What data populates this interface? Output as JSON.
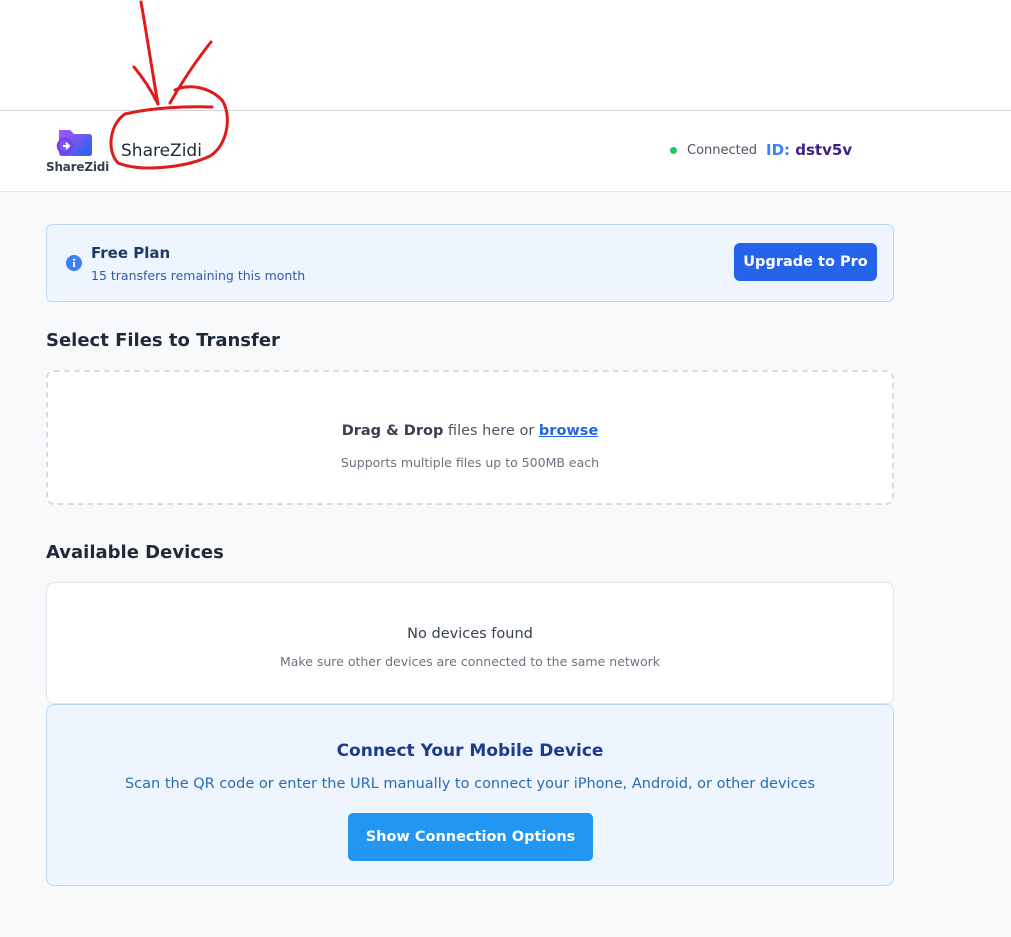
{
  "header": {
    "logo_caption": "ShareZidi",
    "app_name": "ShareZidi",
    "status_text": "Connected",
    "id_label": "ID:",
    "id_value": "dstv5v"
  },
  "plan": {
    "title": "Free Plan",
    "subtitle": "15 transfers remaining this month",
    "upgrade_label": "Upgrade to Pro"
  },
  "files": {
    "section_title": "Select Files to Transfer",
    "drop_strong": "Drag & Drop",
    "drop_middle": " files here or ",
    "browse_link": "browse",
    "drop_note": "Supports multiple files up to 500MB each"
  },
  "devices": {
    "section_title": "Available Devices",
    "empty_title": "No devices found",
    "empty_note": "Make sure other devices are connected to the same network"
  },
  "mobile": {
    "title": "Connect Your Mobile Device",
    "subtitle": "Scan the QR code or enter the URL manually to connect your iPhone, Android, or other devices",
    "button_label": "Show Connection Options"
  },
  "colors": {
    "accent": "#2563eb",
    "connection_button": "#2196f3",
    "status_connected": "#22c55e",
    "annotation": "#e01b1b"
  },
  "icons": {
    "logo": "folder-share-logo",
    "info": "info-circle-icon"
  }
}
